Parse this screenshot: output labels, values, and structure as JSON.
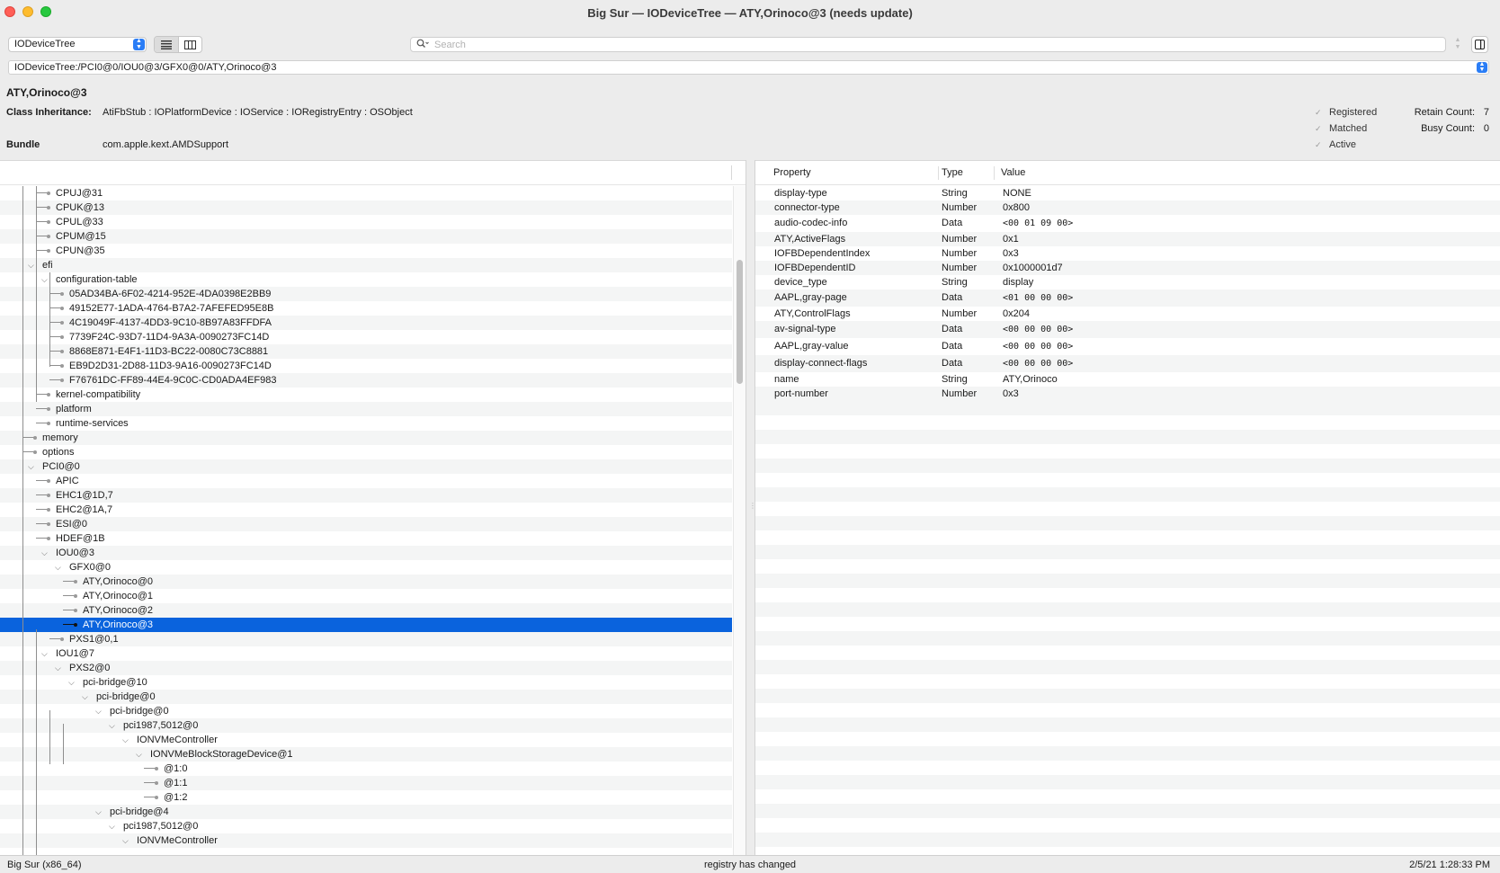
{
  "window": {
    "title": "Big Sur — IODeviceTree — ATY,Orinoco@3 (needs update)"
  },
  "toolbar": {
    "plane": "IODeviceTree",
    "search_placeholder": "Search",
    "icons": {
      "list_view": "list-view-icon",
      "column_view": "column-view-icon",
      "search": "magnifier-icon",
      "inspector": "sidebar-icon"
    }
  },
  "path": "IODeviceTree:/PCI0@0/IOU0@3/GFX0@0/ATY,Orinoco@3",
  "info": {
    "name": "ATY,Orinoco@3",
    "class_inheritance_label": "Class Inheritance:",
    "class_inheritance": "AtiFbStub : IOPlatformDevice : IOService : IORegistryEntry : OSObject",
    "bundle_label": "Bundle",
    "bundle": "com.apple.kext.AMDSupport",
    "registered": "Registered",
    "matched": "Matched",
    "active": "Active",
    "retain_count_label": "Retain Count:",
    "retain_count": "7",
    "busy_count_label": "Busy Count:",
    "busy_count": "0"
  },
  "tree": [
    {
      "label": "CPUJ@31",
      "depth": 2
    },
    {
      "label": "CPUK@13",
      "depth": 2
    },
    {
      "label": "CPUL@33",
      "depth": 2
    },
    {
      "label": "CPUM@15",
      "depth": 2
    },
    {
      "label": "CPUN@35",
      "depth": 2
    },
    {
      "label": "efi",
      "depth": 1,
      "expanded": true
    },
    {
      "label": "configuration-table",
      "depth": 2,
      "expanded": true
    },
    {
      "label": "05AD34BA-6F02-4214-952E-4DA0398E2BB9",
      "depth": 3
    },
    {
      "label": "49152E77-1ADA-4764-B7A2-7AFEFED95E8B",
      "depth": 3
    },
    {
      "label": "4C19049F-4137-4DD3-9C10-8B97A83FFDFA",
      "depth": 3
    },
    {
      "label": "7739F24C-93D7-11D4-9A3A-0090273FC14D",
      "depth": 3
    },
    {
      "label": "8868E871-E4F1-11D3-BC22-0080C73C8881",
      "depth": 3
    },
    {
      "label": "EB9D2D31-2D88-11D3-9A16-0090273FC14D",
      "depth": 3
    },
    {
      "label": "F76761DC-FF89-44E4-9C0C-CD0ADA4EF983",
      "depth": 3
    },
    {
      "label": "kernel-compatibility",
      "depth": 2
    },
    {
      "label": "platform",
      "depth": 2
    },
    {
      "label": "runtime-services",
      "depth": 2
    },
    {
      "label": "memory",
      "depth": 1
    },
    {
      "label": "options",
      "depth": 1
    },
    {
      "label": "PCI0@0",
      "depth": 1,
      "expanded": true
    },
    {
      "label": "APIC",
      "depth": 2
    },
    {
      "label": "EHC1@1D,7",
      "depth": 2
    },
    {
      "label": "EHC2@1A,7",
      "depth": 2
    },
    {
      "label": "ESI@0",
      "depth": 2
    },
    {
      "label": "HDEF@1B",
      "depth": 2
    },
    {
      "label": "IOU0@3",
      "depth": 2,
      "expanded": true
    },
    {
      "label": "GFX0@0",
      "depth": 3,
      "expanded": true
    },
    {
      "label": "ATY,Orinoco@0",
      "depth": 4
    },
    {
      "label": "ATY,Orinoco@1",
      "depth": 4
    },
    {
      "label": "ATY,Orinoco@2",
      "depth": 4
    },
    {
      "label": "ATY,Orinoco@3",
      "depth": 4,
      "selected": true
    },
    {
      "label": "PXS1@0,1",
      "depth": 3
    },
    {
      "label": "IOU1@7",
      "depth": 2,
      "expanded": true
    },
    {
      "label": "PXS2@0",
      "depth": 3,
      "expanded": true
    },
    {
      "label": "pci-bridge@10",
      "depth": 4,
      "expanded": true
    },
    {
      "label": "pci-bridge@0",
      "depth": 5,
      "expanded": true
    },
    {
      "label": "pci-bridge@0",
      "depth": 6,
      "expanded": true
    },
    {
      "label": "pci1987,5012@0",
      "depth": 7,
      "expanded": true
    },
    {
      "label": "IONVMeController",
      "depth": 8,
      "expanded": true
    },
    {
      "label": "IONVMeBlockStorageDevice@1",
      "depth": 9,
      "expanded": true
    },
    {
      "label": "@1:0",
      "depth": 10
    },
    {
      "label": "@1:1",
      "depth": 10
    },
    {
      "label": "@1:2",
      "depth": 10
    },
    {
      "label": "pci-bridge@4",
      "depth": 6,
      "expanded": true
    },
    {
      "label": "pci1987,5012@0",
      "depth": 7,
      "expanded": true
    },
    {
      "label": "IONVMeController",
      "depth": 8,
      "expanded": true
    }
  ],
  "properties": {
    "headers": [
      "Property",
      "Type",
      "Value"
    ],
    "rows": [
      {
        "property": "display-type",
        "type": "String",
        "value": "NONE"
      },
      {
        "property": "connector-type",
        "type": "Number",
        "value": "0x800"
      },
      {
        "property": "audio-codec-info",
        "type": "Data",
        "value": "<00 01 09 00>",
        "mono": true
      },
      {
        "property": "ATY,ActiveFlags",
        "type": "Number",
        "value": "0x1"
      },
      {
        "property": "IOFBDependentIndex",
        "type": "Number",
        "value": "0x3"
      },
      {
        "property": "IOFBDependentID",
        "type": "Number",
        "value": "0x1000001d7"
      },
      {
        "property": "device_type",
        "type": "String",
        "value": "display"
      },
      {
        "property": "AAPL,gray-page",
        "type": "Data",
        "value": "<01 00 00 00>",
        "mono": true
      },
      {
        "property": "ATY,ControlFlags",
        "type": "Number",
        "value": "0x204"
      },
      {
        "property": "av-signal-type",
        "type": "Data",
        "value": "<00 00 00 00>",
        "mono": true
      },
      {
        "property": "AAPL,gray-value",
        "type": "Data",
        "value": "<00 00 00 00>",
        "mono": true
      },
      {
        "property": "display-connect-flags",
        "type": "Data",
        "value": "<00 00 00 00>",
        "mono": true
      },
      {
        "property": "name",
        "type": "String",
        "value": "ATY,Orinoco"
      },
      {
        "property": "port-number",
        "type": "Number",
        "value": "0x3"
      }
    ]
  },
  "status": {
    "left": "Big Sur (x86_64)",
    "center": "registry has changed",
    "right": "2/5/21 1:28:33 PM"
  },
  "colors": {
    "selection": "#0a63dd",
    "accent": "#2a7df6"
  }
}
